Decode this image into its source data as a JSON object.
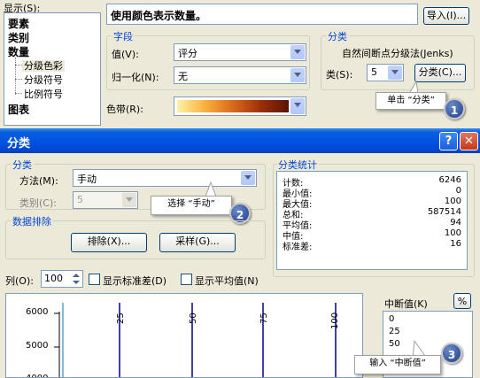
{
  "top": {
    "show_label": "显示(S):",
    "tree": {
      "features": "要素",
      "categories": "类别",
      "quantities": "数量",
      "graduated_colors": "分级色彩",
      "graduated_symbols": "分级符号",
      "proportional_symbols": "比例符号",
      "charts": "图表"
    },
    "description": "使用颜色表示数量。",
    "import_button": "导入(I)...",
    "fields": {
      "title": "字段",
      "value_label": "值(V):",
      "value_selected": "评分",
      "normalization_label": "归一化(N):",
      "normalization_selected": "无"
    },
    "classification": {
      "title": "分类",
      "method_text": "自然间断点分级法(Jenks)",
      "classes_label": "类(S):",
      "classes_value": "5",
      "classify_button": "分类(C)..."
    },
    "color_ramp_label": "色带(R):",
    "callout_1": "单击 “分类”",
    "badge_1": "1"
  },
  "dialog": {
    "title": "分类",
    "help_glyph": "?",
    "close_glyph": "✕",
    "classification": {
      "title": "分类",
      "method_label": "方法(M):",
      "method_value": "手动",
      "classes_label": "类别(C):",
      "classes_value": "5"
    },
    "callout_2": "选择 “手动”",
    "badge_2": "2",
    "exclusion": {
      "title": "数据排除",
      "exclude_button": "排除(X)...",
      "sampling_button": "采样(G)..."
    },
    "statistics": {
      "title": "分类统计",
      "rows": [
        {
          "k": "计数:",
          "v": "6246"
        },
        {
          "k": "最小值:",
          "v": "0"
        },
        {
          "k": "最大值:",
          "v": "100"
        },
        {
          "k": "总和:",
          "v": "587514"
        },
        {
          "k": "平均值:",
          "v": "94"
        },
        {
          "k": "中值:",
          "v": "100"
        },
        {
          "k": "标准差:",
          "v": "16"
        }
      ]
    },
    "columns_label": "列(O):",
    "columns_value": "100",
    "show_std_label": "显示标准差(D)",
    "show_mean_label": "显示平均值(N)",
    "histogram": {
      "y_ticks": [
        "6000",
        "5000",
        "4000"
      ],
      "x_ticks": [
        "25",
        "50",
        "75",
        "100"
      ]
    },
    "break_values_label": "中断值(K)",
    "percent_button": "%",
    "break_values": [
      "0",
      "25",
      "50"
    ],
    "callout_3": "输入 “中断值”",
    "badge_3": "3"
  }
}
